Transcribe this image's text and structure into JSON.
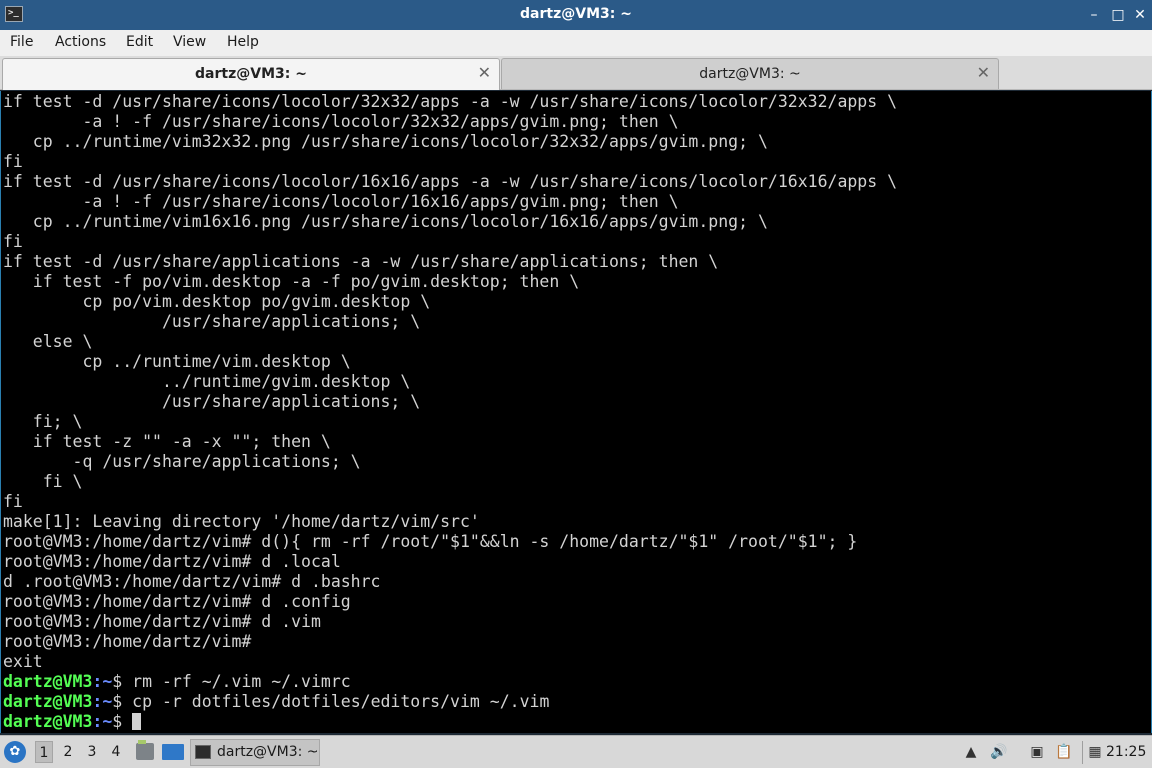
{
  "window": {
    "title": "dartz@VM3: ~",
    "app_icon": "terminal-icon",
    "controls": {
      "minimize": "–",
      "maximize": "□",
      "close": "✕"
    }
  },
  "menu": [
    "File",
    "Actions",
    "Edit",
    "View",
    "Help"
  ],
  "tabs": [
    {
      "label": "dartz@VM3: ~",
      "active": true,
      "close": "✕"
    },
    {
      "label": "dartz@VM3: ~",
      "active": false,
      "close": "✕"
    }
  ],
  "terminal": {
    "lines": [
      "if test -d /usr/share/icons/locolor/32x32/apps -a -w /usr/share/icons/locolor/32x32/apps \\",
      "        -a ! -f /usr/share/icons/locolor/32x32/apps/gvim.png; then \\",
      "   cp ../runtime/vim32x32.png /usr/share/icons/locolor/32x32/apps/gvim.png; \\",
      "fi",
      "if test -d /usr/share/icons/locolor/16x16/apps -a -w /usr/share/icons/locolor/16x16/apps \\",
      "        -a ! -f /usr/share/icons/locolor/16x16/apps/gvim.png; then \\",
      "   cp ../runtime/vim16x16.png /usr/share/icons/locolor/16x16/apps/gvim.png; \\",
      "fi",
      "if test -d /usr/share/applications -a -w /usr/share/applications; then \\",
      "   if test -f po/vim.desktop -a -f po/gvim.desktop; then \\",
      "        cp po/vim.desktop po/gvim.desktop \\",
      "                /usr/share/applications; \\",
      "   else \\",
      "        cp ../runtime/vim.desktop \\",
      "                ../runtime/gvim.desktop \\",
      "                /usr/share/applications; \\",
      "   fi; \\",
      "   if test -z \"\" -a -x \"\"; then \\",
      "       -q /usr/share/applications; \\",
      "    fi \\",
      "fi",
      "make[1]: Leaving directory '/home/dartz/vim/src'",
      "root@VM3:/home/dartz/vim# d(){ rm -rf /root/\"$1\"&&ln -s /home/dartz/\"$1\" /root/\"$1\"; }",
      "root@VM3:/home/dartz/vim# d .local",
      "d .root@VM3:/home/dartz/vim# d .bashrc",
      "root@VM3:/home/dartz/vim# d .config",
      "root@VM3:/home/dartz/vim# d .vim",
      "root@VM3:/home/dartz/vim#",
      "exit"
    ],
    "prompt_user": "dartz@VM3",
    "prompt_path": ":~",
    "prompt_symbol": "$ ",
    "prompt_commands": [
      "rm -rf ~/.vim ~/.vimrc",
      "cp -r dotfiles/dotfiles/editors/vim ~/.vim",
      ""
    ]
  },
  "taskbar": {
    "workspaces": [
      "1",
      "2",
      "3",
      "4"
    ],
    "current_workspace": "1",
    "task_label": "dartz@VM3: ~",
    "clock": "21:25"
  },
  "colors": {
    "titlebar": "#2b5a88",
    "terminal_bg": "#000000",
    "terminal_fg": "#d3d3d3",
    "prompt_user": "#54ff54",
    "prompt_path": "#6b8cff"
  }
}
